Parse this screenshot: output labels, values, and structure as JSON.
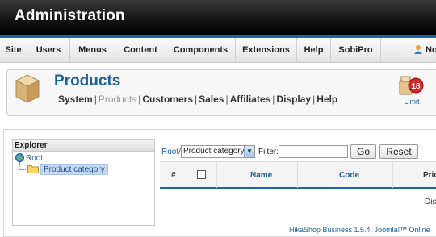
{
  "header": {
    "title": "Administration"
  },
  "menubar": {
    "items": [
      {
        "label": "Site"
      },
      {
        "label": "Users"
      },
      {
        "label": "Menus"
      },
      {
        "label": "Content"
      },
      {
        "label": "Components"
      },
      {
        "label": "Extensions"
      },
      {
        "label": "Help"
      },
      {
        "label": "SobiPro"
      }
    ],
    "user_label": "No"
  },
  "toolbar": {
    "title": "Products",
    "submenu": {
      "system": "System",
      "products": "Products",
      "customers": "Customers",
      "sales": "Sales",
      "affiliates": "Affiliates",
      "display": "Display",
      "help": "Help"
    },
    "limit_label": "Limit"
  },
  "explorer": {
    "title": "Explorer",
    "root": "Root",
    "child": "Product category"
  },
  "filter": {
    "breadcrumb": "Root/",
    "category_value": "Product category",
    "filter_label": "Filter:",
    "filter_value": "",
    "go_label": "Go",
    "reset_label": "Reset"
  },
  "table": {
    "columns": {
      "num": "#",
      "name": "Name",
      "code": "Code",
      "price": "Pric"
    },
    "row_text": "Dis"
  },
  "footer": {
    "text": "HikaShop Business 1.5.4, Joomla!™ Online"
  },
  "colors": {
    "accent": "#1b63b1",
    "link": "#1d5e9c",
    "header_bg": "#111111"
  }
}
